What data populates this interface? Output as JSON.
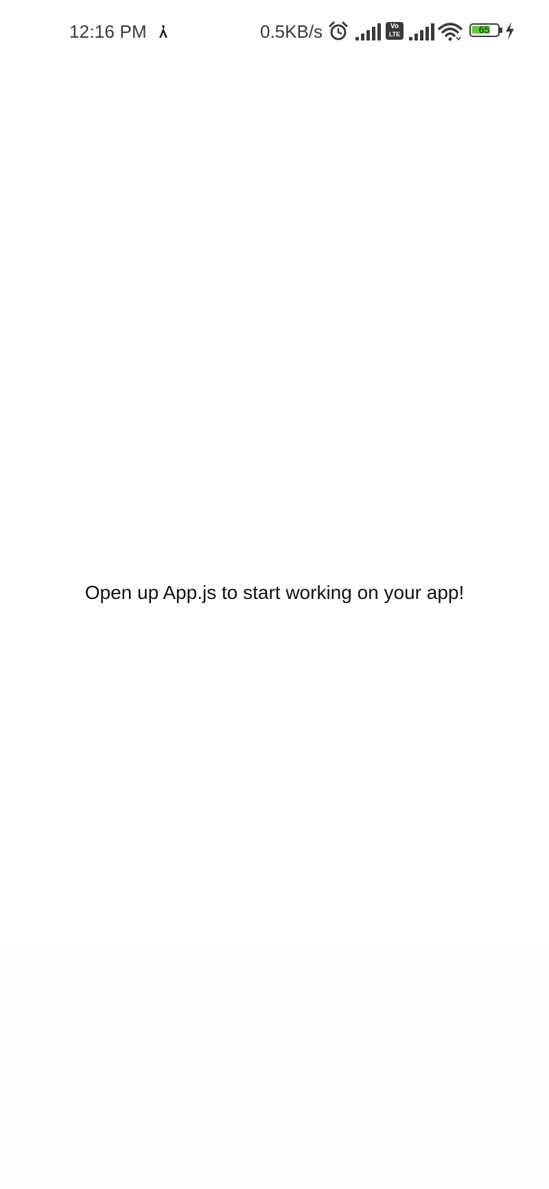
{
  "status_bar": {
    "time": "12:16 PM",
    "network_speed": "0.5KB/s",
    "battery_level": "65",
    "volte_label_top": "Vo",
    "volte_label_bottom": "LTE",
    "icons": [
      "notification-icon",
      "alarm-icon",
      "signal-icon",
      "volte-icon",
      "signal-icon",
      "wifi-icon",
      "battery-icon",
      "charging-icon"
    ],
    "colors": {
      "text": "#3a3a3a",
      "battery_fill": "#5cc93c"
    }
  },
  "main": {
    "message": "Open up App.js to start working on your app!"
  }
}
